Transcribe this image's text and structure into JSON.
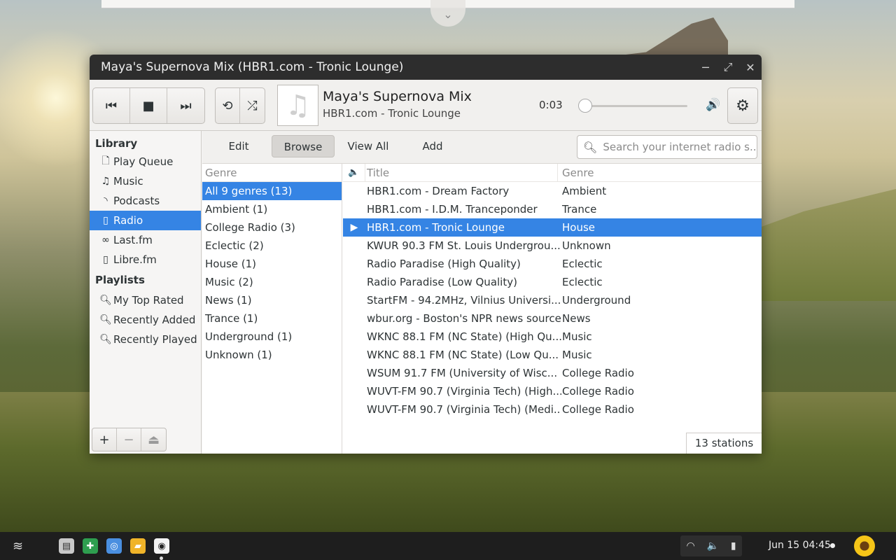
{
  "window": {
    "title": "Maya's Supernova Mix (HBR1.com - Tronic Lounge)",
    "minimize_icon": "minimize-icon",
    "maximize_icon": "maximize-icon",
    "close_icon": "close-icon"
  },
  "player": {
    "now_playing_title": "Maya's Supernova Mix",
    "now_playing_subtitle": "HBR1.com - Tronic Lounge",
    "time": "0:03",
    "progress": 0.0
  },
  "sidebar": {
    "library_heading": "Library",
    "library_items": [
      {
        "label": "Play Queue",
        "icon": "document-icon"
      },
      {
        "label": "Music",
        "icon": "music-note-icon"
      },
      {
        "label": "Podcasts",
        "icon": "rss-icon"
      },
      {
        "label": "Radio",
        "icon": "radio-icon"
      },
      {
        "label": "Last.fm",
        "icon": "lastfm-icon"
      },
      {
        "label": "Libre.fm",
        "icon": "radio-icon"
      }
    ],
    "playlists_heading": "Playlists",
    "playlist_items": [
      {
        "label": "My Top Rated",
        "icon": "search-icon"
      },
      {
        "label": "Recently Added",
        "icon": "search-icon"
      },
      {
        "label": "Recently Played",
        "icon": "search-icon"
      }
    ]
  },
  "tabs": {
    "edit": "Edit",
    "browse": "Browse",
    "view_all": "View All",
    "add": "Add"
  },
  "search": {
    "placeholder": "Search your internet radio s..."
  },
  "genre_pane": {
    "header": "Genre",
    "items": [
      "All 9 genres (13)",
      "Ambient (1)",
      "College Radio (3)",
      "Eclectic (2)",
      "House (1)",
      "Music (2)",
      "News (1)",
      "Trance (1)",
      "Underground (1)",
      "Unknown (1)"
    ]
  },
  "stations": {
    "header_title": "Title",
    "header_genre": "Genre",
    "rows": [
      {
        "title": "HBR1.com - Dream Factory",
        "genre": "Ambient"
      },
      {
        "title": "HBR1.com - I.D.M. Tranceponder",
        "genre": "Trance"
      },
      {
        "title": "HBR1.com - Tronic Lounge",
        "genre": "House"
      },
      {
        "title": "KWUR 90.3 FM St. Louis Undergrou...",
        "genre": "Unknown"
      },
      {
        "title": "Radio Paradise (High Quality)",
        "genre": "Eclectic"
      },
      {
        "title": "Radio Paradise (Low Quality)",
        "genre": "Eclectic"
      },
      {
        "title": "StartFM - 94.2MHz, Vilnius Universi...",
        "genre": "Underground"
      },
      {
        "title": "wbur.org - Boston's NPR news source",
        "genre": "News"
      },
      {
        "title": "WKNC 88.1 FM (NC State) (High Qu...",
        "genre": "Music"
      },
      {
        "title": "WKNC 88.1 FM (NC State) (Low Qu...",
        "genre": "Music"
      },
      {
        "title": "WSUM 91.7 FM (University of Wisc...",
        "genre": "College Radio"
      },
      {
        "title": "WUVT-FM 90.7 (Virginia Tech) (High...",
        "genre": "College Radio"
      },
      {
        "title": "WUVT-FM 90.7 (Virginia Tech) (Medi...",
        "genre": "College Radio"
      }
    ],
    "count": "13 stations"
  },
  "taskbar": {
    "clock": "Jun 15  04:45"
  },
  "colors": {
    "selection": "#3584e4",
    "titlebar": "#2d2d2d",
    "taskbar": "#1e1e1e"
  }
}
